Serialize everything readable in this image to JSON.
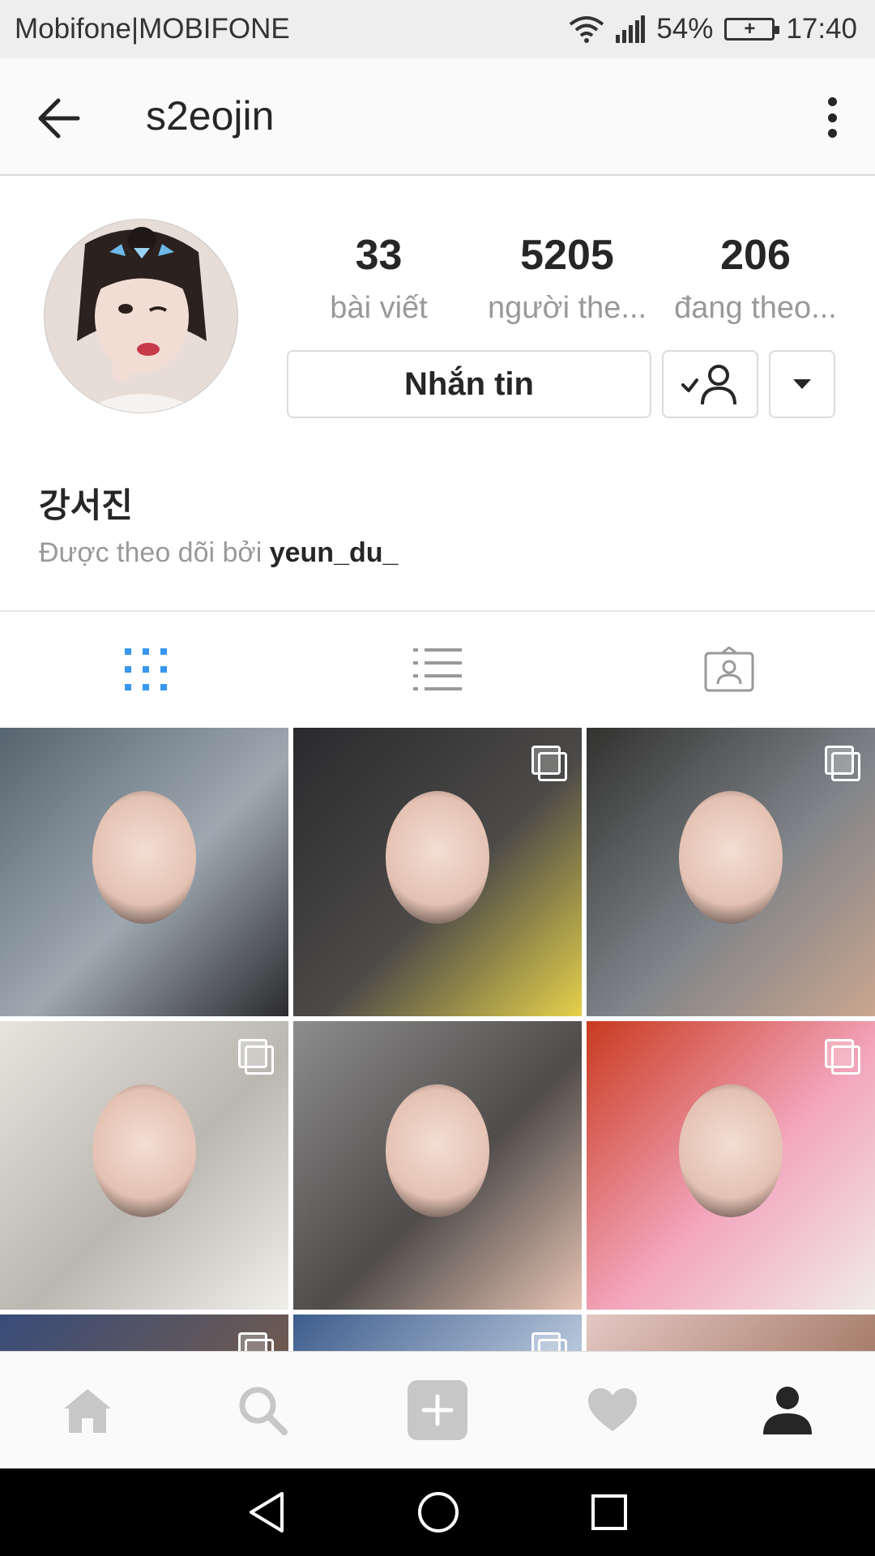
{
  "status_bar": {
    "carrier": "Mobifone|MOBIFONE",
    "battery_percent": "54%",
    "time": "17:40"
  },
  "header": {
    "username": "s2eojin"
  },
  "stats": [
    {
      "count": "33",
      "label": "bài viết"
    },
    {
      "count": "5205",
      "label": "người the..."
    },
    {
      "count": "206",
      "label": "đang theo..."
    }
  ],
  "actions": {
    "message_label": "Nhắn tin"
  },
  "profile": {
    "name": "강서진",
    "followed_by_prefix": "Được theo dõi bởi",
    "followed_by_user": "yeun_du_"
  },
  "view_tabs": [
    {
      "name": "grid",
      "active": true
    },
    {
      "name": "list",
      "active": false
    },
    {
      "name": "tagged",
      "active": false
    }
  ],
  "colors": {
    "accent": "#3897f0",
    "icon_gray": "#c7c7c7",
    "text": "#262626",
    "muted": "#999999"
  },
  "photos": [
    {
      "multi": false,
      "palette": [
        "#56646f",
        "#9ea8b1",
        "#2b2b2d"
      ]
    },
    {
      "multi": true,
      "palette": [
        "#2a2a2d",
        "#4c4a48",
        "#e5d14a"
      ]
    },
    {
      "multi": true,
      "palette": [
        "#31312f",
        "#808489",
        "#caa68f"
      ]
    },
    {
      "multi": true,
      "palette": [
        "#e7e4dc",
        "#bab7b1",
        "#f0eee8"
      ]
    },
    {
      "multi": false,
      "palette": [
        "#8d8d8d",
        "#4f4c4a",
        "#e7c4b4"
      ]
    },
    {
      "multi": true,
      "palette": [
        "#c93a1f",
        "#f3a7be",
        "#f0ebe8"
      ]
    },
    {
      "multi": true,
      "palette": [
        "#384c7a",
        "#6d5a51",
        "#1f2738"
      ]
    },
    {
      "multi": true,
      "palette": [
        "#3e5d8d",
        "#b4c4d9",
        "#2c2f35"
      ]
    },
    {
      "multi": false,
      "palette": [
        "#e4c7c4",
        "#a97f6d",
        "#d9b5ad"
      ]
    }
  ]
}
